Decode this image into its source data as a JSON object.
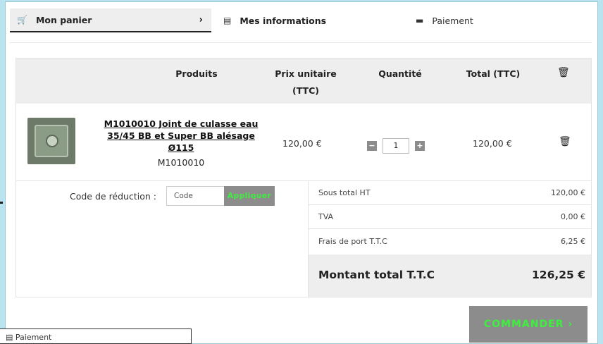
{
  "steps": [
    {
      "label": "Mon panier",
      "icon": "cart-icon",
      "chevron": "›"
    },
    {
      "label": "Mes informations",
      "icon": "id-card-icon"
    },
    {
      "label": "Paiement",
      "icon": "credit-card-icon"
    }
  ],
  "table": {
    "headers": {
      "product": "Produits",
      "unit_price_line1": "Prix unitaire",
      "unit_price_line2": "(TTC)",
      "quantity": "Quantité",
      "total": "Total (TTC)"
    },
    "rows": [
      {
        "name": "M1010010 Joint de culasse eau 35/45 BB et Super BB alésage Ø115",
        "ref": "M1010010",
        "unit_price": "120,00 €",
        "quantity": "1",
        "total": "120,00 €"
      }
    ]
  },
  "promo": {
    "label": "Code de réduction :",
    "placeholder": "Code",
    "button": "Appliquer"
  },
  "summary": {
    "lines": [
      {
        "label": "Sous total HT",
        "value": "120,00 €"
      },
      {
        "label": "TVA",
        "value": "0,00 €"
      },
      {
        "label": "Frais de port T.T.C",
        "value": "6,25 €"
      }
    ],
    "total_label": "Montant total T.T.C",
    "total_value": "126,25 €"
  },
  "order_button": "COMMANDER ›",
  "tooltip_text": "Paiement",
  "colors": {
    "accent_text": "#3ef03e",
    "button_bg": "#8c8c8c",
    "page_bg": "#b9e3ee"
  }
}
